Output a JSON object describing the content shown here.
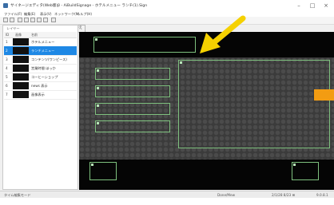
{
  "window": {
    "title": "サイネージエディタ(Web版)β - AiBuildSignage - ホテルメニュー ランチ(1).Sign",
    "minimize_glyph": "–",
    "maximize_glyph": "□",
    "close_glyph": "×"
  },
  "menu": [
    "ファイル(F)",
    "編集(E)",
    "表示(V)",
    "ネットワーク(N)",
    "ヘルプ(H)"
  ],
  "toolbar": {
    "icons": [
      "save-icon",
      "open-icon",
      "undo-icon",
      "redo-icon",
      "copy-icon",
      "paste-icon",
      "delete-icon",
      "play-icon"
    ]
  },
  "edit_mode_tab": "修正モードの切り替え",
  "layers": {
    "label": "レイヤー",
    "columns": [
      "ID",
      "画像",
      "名前"
    ],
    "rows": [
      {
        "num": "1",
        "name": "ホテルメニュー"
      },
      {
        "num": "2",
        "name": "ランチメニュー"
      },
      {
        "num": "3",
        "name": "コンテンツ(ワンピース)"
      },
      {
        "num": "4",
        "name": "営業時間 ほっか"
      },
      {
        "num": "5",
        "name": "コーヒーショップ"
      },
      {
        "num": "6",
        "name": "news 表示"
      },
      {
        "num": "7",
        "name": "画像表示"
      }
    ]
  },
  "stage": {
    "accent_color": "#f39c12",
    "frame_color": "#7ec07e",
    "arrow_color": "#f5d100"
  },
  "status": {
    "left": "タイム編集モード",
    "middle": "Done/Mew",
    "right": "2/1/28 8/23 ⊞",
    "far_right": "9.0.8.1"
  }
}
